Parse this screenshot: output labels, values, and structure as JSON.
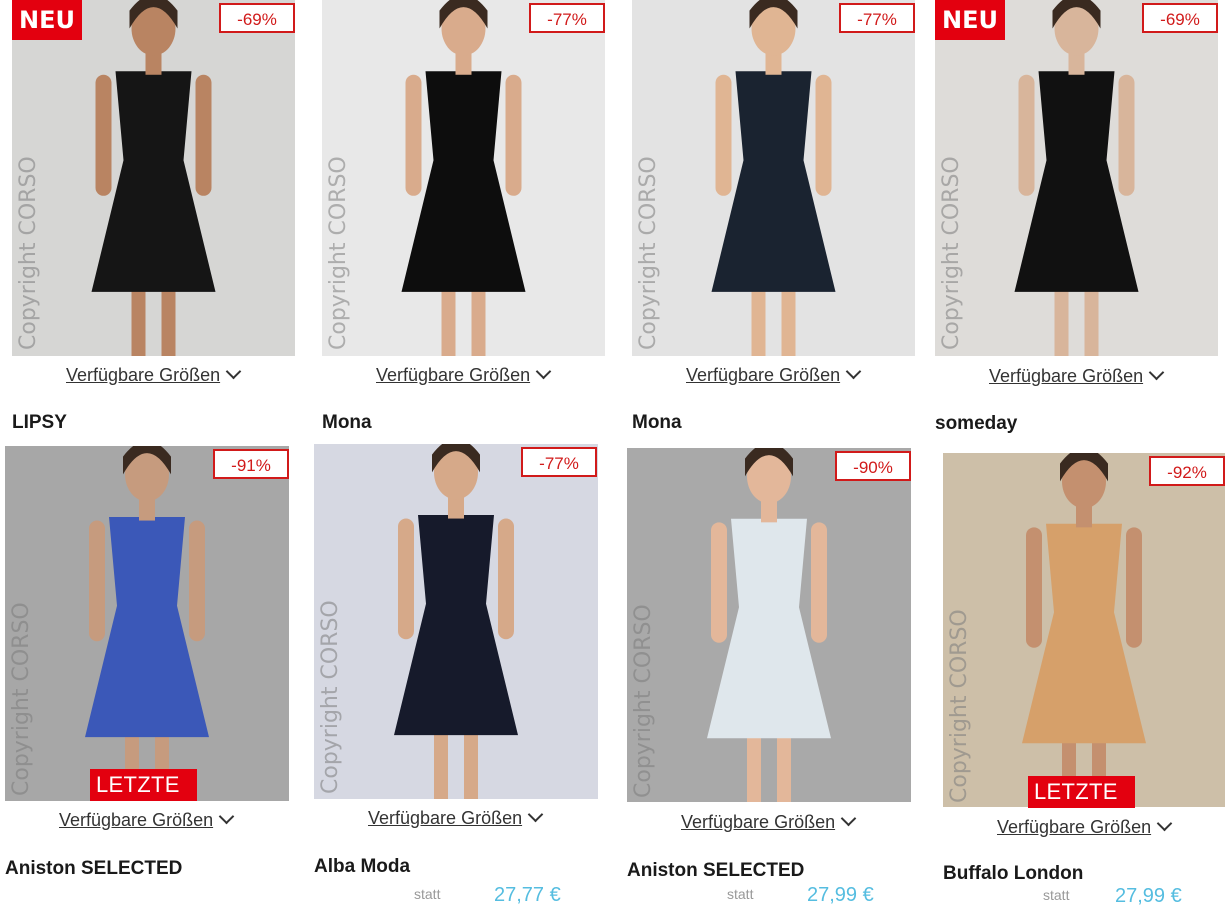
{
  "products": [
    {
      "brand": "LIPSY",
      "badge_new": "NEU",
      "discount": "-69%",
      "sizes_label": "Verfügbare Größen",
      "watermark": "Copyright CORSO",
      "bg": "#d6d6d4",
      "garment": "#151515",
      "skin": "#b98462"
    },
    {
      "brand": "Mona",
      "discount": "-77%",
      "sizes_label": "Verfügbare Größen",
      "watermark": "Copyright CORSO",
      "bg": "#e8e8e8",
      "garment": "#0d0d0d",
      "skin": "#d9ab8c"
    },
    {
      "brand": "Mona",
      "discount": "-77%",
      "sizes_label": "Verfügbare Größen",
      "watermark": "Copyright CORSO",
      "bg": "#e3e3e3",
      "garment": "#1a2330",
      "skin": "#e0b593"
    },
    {
      "brand": "someday",
      "badge_new": "NEU",
      "discount": "-69%",
      "sizes_label": "Verfügbare Größen",
      "watermark": "Copyright CORSO",
      "bg": "#dedcd9",
      "garment": "#111111",
      "skin": "#d8b59b"
    },
    {
      "brand": "Aniston SELECTED",
      "discount": "-91%",
      "chance": "LETZTE CHANCE",
      "sizes_label": "Verfügbare Größen",
      "watermark": "Copyright CORSO",
      "bg": "#a7a7a7",
      "garment": "#3b58b8",
      "skin": "#c69b7e"
    },
    {
      "brand": "Alba Moda",
      "discount": "-77%",
      "sizes_label": "Verfügbare Größen",
      "watermark": "Copyright CORSO",
      "bg": "#d6d8e2",
      "garment": "#161a2b",
      "skin": "#d6a989",
      "price_old": "statt",
      "price": "27,77 €"
    },
    {
      "brand": "Aniston SELECTED",
      "discount": "-90%",
      "sizes_label": "Verfügbare Größen",
      "watermark": "Copyright CORSO",
      "bg": "#a9a9a9",
      "garment": "#dfe7ec",
      "skin": "#e3b79a",
      "price_old": "statt",
      "price": "27,99 €"
    },
    {
      "brand": "Buffalo London",
      "discount": "-92%",
      "chance": "LETZTE CHANCE",
      "sizes_label": "Verfügbare Größen",
      "watermark": "Copyright CORSO",
      "bg": "#cdbfa8",
      "garment": "#d6a06a",
      "skin": "#c4906f",
      "price_old": "statt",
      "price": "27,99 €"
    }
  ]
}
